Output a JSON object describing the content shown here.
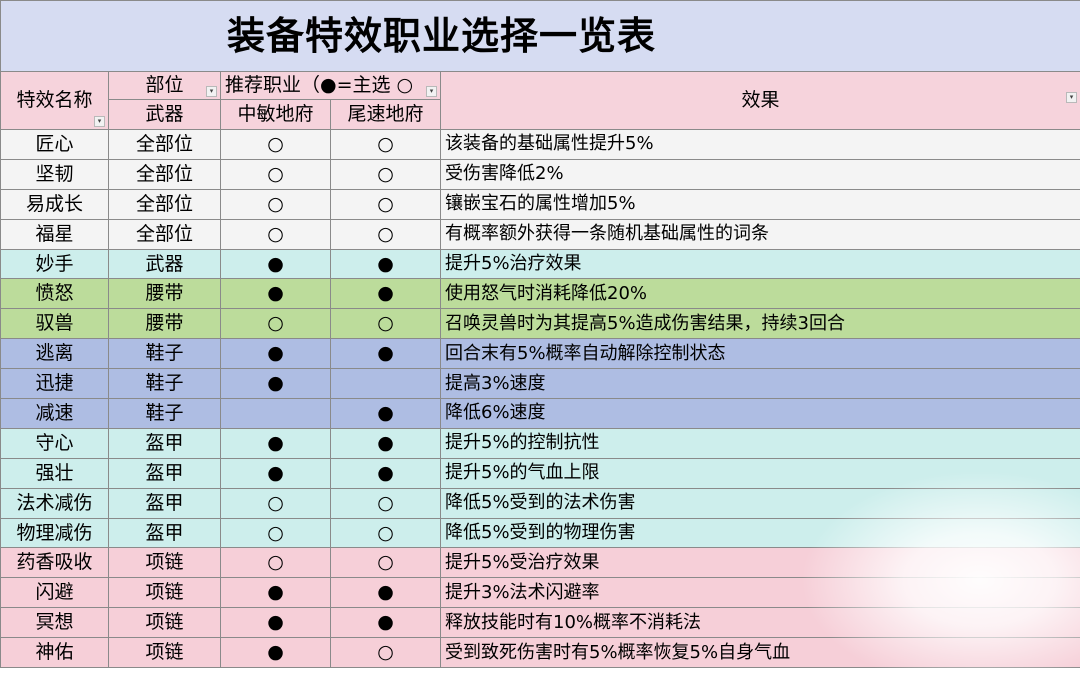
{
  "title": "装备特效职业选择一览表",
  "headers": {
    "name": "特效名称",
    "part_top": "部位",
    "part_bottom": "武器",
    "rec": "推荐职业（●=主选 ○",
    "col1": "中敏地府",
    "col2": "尾速地府",
    "effect": "效果"
  },
  "rows": [
    {
      "name": "匠心",
      "part": "全部位",
      "a": "○",
      "b": "○",
      "effect": "该装备的基础属性提升5%",
      "color": "white"
    },
    {
      "name": "坚韧",
      "part": "全部位",
      "a": "○",
      "b": "○",
      "effect": "受伤害降低2%",
      "color": "white"
    },
    {
      "name": "易成长",
      "part": "全部位",
      "a": "○",
      "b": "○",
      "effect": "镶嵌宝石的属性增加5%",
      "color": "white"
    },
    {
      "name": "福星",
      "part": "全部位",
      "a": "○",
      "b": "○",
      "effect": "有概率额外获得一条随机基础属性的词条",
      "color": "white"
    },
    {
      "name": "妙手",
      "part": "武器",
      "a": "●",
      "b": "●",
      "effect": "提升5%治疗效果",
      "color": "cyan"
    },
    {
      "name": "愤怒",
      "part": "腰带",
      "a": "●",
      "b": "●",
      "effect": "使用怒气时消耗降低20%",
      "color": "green"
    },
    {
      "name": "驭兽",
      "part": "腰带",
      "a": "○",
      "b": "○",
      "effect": "召唤灵兽时为其提高5%造成伤害结果，持续3回合",
      "color": "green"
    },
    {
      "name": "逃离",
      "part": "鞋子",
      "a": "●",
      "b": "●",
      "effect": "回合末有5%概率自动解除控制状态",
      "color": "blue"
    },
    {
      "name": "迅捷",
      "part": "鞋子",
      "a": "●",
      "b": "",
      "effect": "提高3%速度",
      "color": "blue"
    },
    {
      "name": "减速",
      "part": "鞋子",
      "a": "",
      "b": "●",
      "effect": "降低6%速度",
      "color": "blue"
    },
    {
      "name": "守心",
      "part": "盔甲",
      "a": "●",
      "b": "●",
      "effect": "提升5%的控制抗性",
      "color": "cyan"
    },
    {
      "name": "强壮",
      "part": "盔甲",
      "a": "●",
      "b": "●",
      "effect": "提升5%的气血上限",
      "color": "cyan"
    },
    {
      "name": "法术减伤",
      "part": "盔甲",
      "a": "○",
      "b": "○",
      "effect": "降低5%受到的法术伤害",
      "color": "cyan"
    },
    {
      "name": "物理减伤",
      "part": "盔甲",
      "a": "○",
      "b": "○",
      "effect": "降低5%受到的物理伤害",
      "color": "cyan"
    },
    {
      "name": "药香吸收",
      "part": "项链",
      "a": "○",
      "b": "○",
      "effect": "提升5%受治疗效果",
      "color": "pink"
    },
    {
      "name": "闪避",
      "part": "项链",
      "a": "●",
      "b": "●",
      "effect": "提升3%法术闪避率",
      "color": "pink"
    },
    {
      "name": "冥想",
      "part": "项链",
      "a": "●",
      "b": "●",
      "effect": "释放技能时有10%概率不消耗法",
      "color": "pink"
    },
    {
      "name": "神佑",
      "part": "项链",
      "a": "●",
      "b": "○",
      "effect": "受到致死伤害时有5%概率恢复5%自身气血",
      "color": "pink"
    }
  ],
  "colors": {
    "title_bg": "#d6dcf2",
    "header_bg": "#f6d3dc",
    "white": "#f4f4f4",
    "cyan": "#cdeeec",
    "green": "#bcdc9b",
    "blue": "#aebde3",
    "pink": "#f6cfd8"
  }
}
